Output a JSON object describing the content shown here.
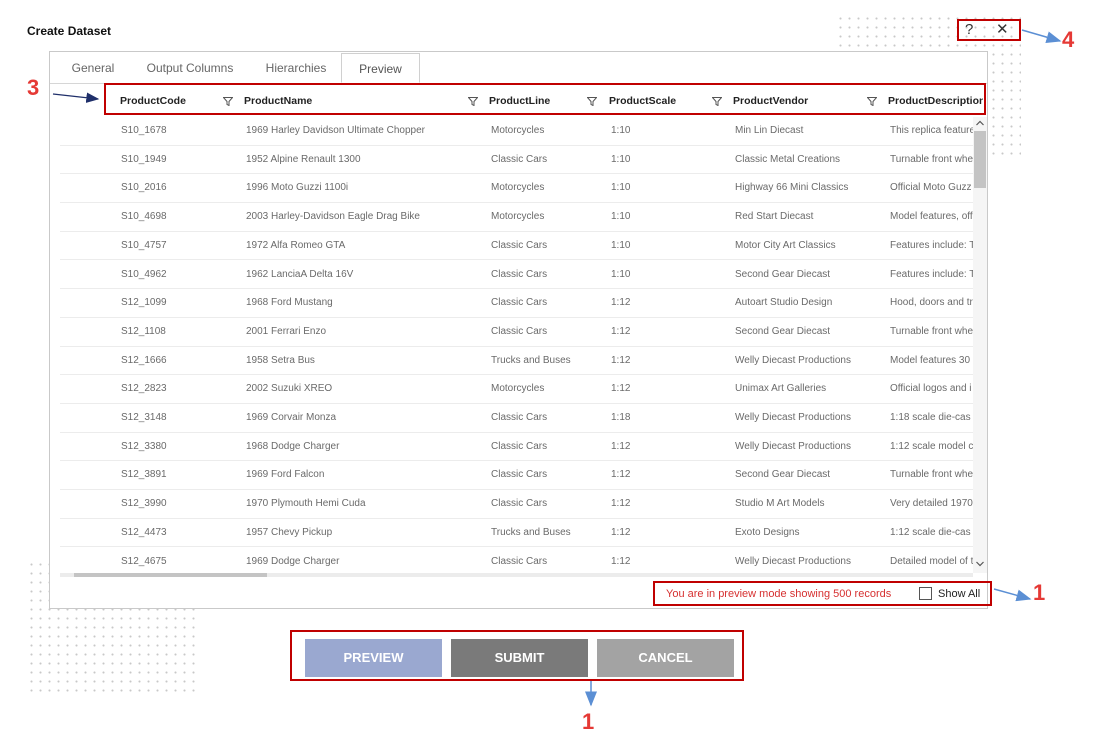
{
  "dialog": {
    "title": "Create Dataset"
  },
  "tabs": [
    {
      "label": "General"
    },
    {
      "label": "Output Columns"
    },
    {
      "label": "Hierarchies"
    },
    {
      "label": "Preview"
    }
  ],
  "window_controls": {
    "help": "?",
    "close": "✕"
  },
  "columns": [
    {
      "label": "ProductCode"
    },
    {
      "label": "ProductName"
    },
    {
      "label": "ProductLine"
    },
    {
      "label": "ProductScale"
    },
    {
      "label": "ProductVendor"
    },
    {
      "label": "ProductDescription"
    }
  ],
  "rows": [
    [
      "S10_1678",
      "1969 Harley Davidson Ultimate Chopper",
      "Motorcycles",
      "1:10",
      "Min Lin Diecast",
      "This replica feature"
    ],
    [
      "S10_1949",
      "1952 Alpine Renault 1300",
      "Classic Cars",
      "1:10",
      "Classic Metal Creations",
      "Turnable front whe"
    ],
    [
      "S10_2016",
      "1996 Moto Guzzi 1100i",
      "Motorcycles",
      "1:10",
      "Highway 66 Mini Classics",
      "Official Moto Guzz"
    ],
    [
      "S10_4698",
      "2003 Harley-Davidson Eagle Drag Bike",
      "Motorcycles",
      "1:10",
      "Red Start Diecast",
      "Model features, off"
    ],
    [
      "S10_4757",
      "1972 Alfa Romeo GTA",
      "Classic Cars",
      "1:10",
      "Motor City Art Classics",
      "Features include: T"
    ],
    [
      "S10_4962",
      "1962 LanciaA Delta 16V",
      "Classic Cars",
      "1:10",
      "Second Gear Diecast",
      "Features include: T"
    ],
    [
      "S12_1099",
      "1968 Ford Mustang",
      "Classic Cars",
      "1:12",
      "Autoart Studio Design",
      "Hood, doors and tr"
    ],
    [
      "S12_1108",
      "2001 Ferrari Enzo",
      "Classic Cars",
      "1:12",
      "Second Gear Diecast",
      "Turnable front whe"
    ],
    [
      "S12_1666",
      "1958 Setra Bus",
      "Trucks and Buses",
      "1:12",
      "Welly Diecast Productions",
      "Model features 30"
    ],
    [
      "S12_2823",
      "2002 Suzuki XREO",
      "Motorcycles",
      "1:12",
      "Unimax Art Galleries",
      "Official logos and i"
    ],
    [
      "S12_3148",
      "1969 Corvair Monza",
      "Classic Cars",
      "1:18",
      "Welly Diecast Productions",
      "1:18 scale die-cas"
    ],
    [
      "S12_3380",
      "1968 Dodge Charger",
      "Classic Cars",
      "1:12",
      "Welly Diecast Productions",
      "1:12 scale model c"
    ],
    [
      "S12_3891",
      "1969 Ford Falcon",
      "Classic Cars",
      "1:12",
      "Second Gear Diecast",
      "Turnable front whe"
    ],
    [
      "S12_3990",
      "1970 Plymouth Hemi Cuda",
      "Classic Cars",
      "1:12",
      "Studio M Art Models",
      "Very detailed 1970"
    ],
    [
      "S12_4473",
      "1957 Chevy Pickup",
      "Trucks and Buses",
      "1:12",
      "Exoto Designs",
      "1:12 scale die-cas"
    ],
    [
      "S12_4675",
      "1969 Dodge Charger",
      "Classic Cars",
      "1:12",
      "Welly Diecast Productions",
      "Detailed model of t"
    ]
  ],
  "status": {
    "message": "You are in preview mode showing 500 records",
    "show_all_label": "Show All",
    "show_all_checked": false
  },
  "buttons": {
    "preview": "PREVIEW",
    "submit": "SUBMIT",
    "cancel": "CANCEL"
  },
  "annotations": [
    "1",
    "1",
    "3",
    "4"
  ],
  "colors": {
    "annotation_red": "#c00000",
    "annotation_number": "#e53935",
    "annotation_arrow": "#5b8fd4",
    "preview_button": "#9aa8d0",
    "submit_button": "#7a7a7a",
    "cancel_button": "#a3a3a3",
    "status_text": "#d63030"
  }
}
